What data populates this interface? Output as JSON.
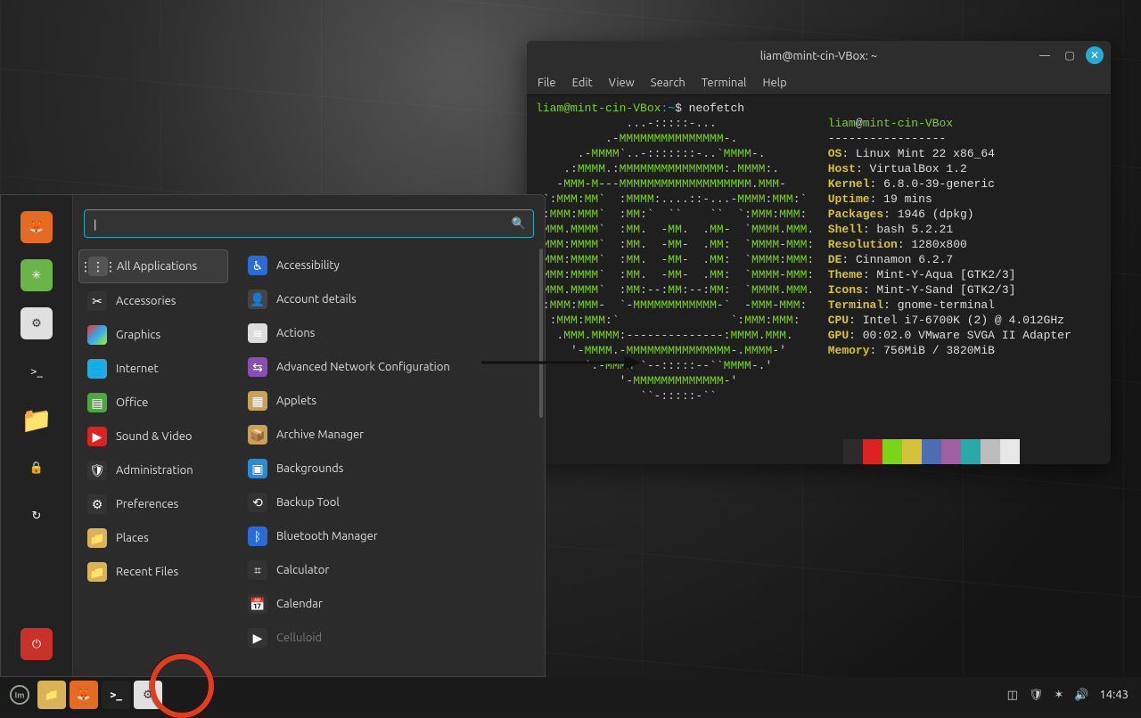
{
  "terminal": {
    "title": "liam@mint-cin-VBox: ~",
    "menu": [
      "File",
      "Edit",
      "View",
      "Search",
      "Terminal",
      "Help"
    ],
    "prompt_user": "liam@mint-cin-VBox",
    "prompt_path": "~",
    "command": "neofetch",
    "info_user": "liam",
    "info_host": "mint-cin-VBox",
    "hr": "-----------------",
    "stats": [
      {
        "k": "OS",
        "v": "Linux Mint 22 x86_64"
      },
      {
        "k": "Host",
        "v": "VirtualBox 1.2"
      },
      {
        "k": "Kernel",
        "v": "6.8.0-39-generic"
      },
      {
        "k": "Uptime",
        "v": "19 mins"
      },
      {
        "k": "Packages",
        "v": "1946 (dpkg)"
      },
      {
        "k": "Shell",
        "v": "bash 5.2.21"
      },
      {
        "k": "Resolution",
        "v": "1280x800"
      },
      {
        "k": "DE",
        "v": "Cinnamon 6.2.7"
      },
      {
        "k": "Theme",
        "v": "Mint-Y-Aqua [GTK2/3]"
      },
      {
        "k": "Icons",
        "v": "Mint-Y-Sand [GTK2/3]"
      },
      {
        "k": "Terminal",
        "v": "gnome-terminal"
      },
      {
        "k": "CPU",
        "v": "Intel i7-6700K (2) @ 4.012GHz"
      },
      {
        "k": "GPU",
        "v": "00:02.0 VMware SVGA II Adapter"
      },
      {
        "k": "Memory",
        "v": "756MiB / 3820MiB"
      }
    ],
    "palette": [
      "#2b2b2b",
      "#d22",
      "#7ad417",
      "#d6c13b",
      "#4d6db5",
      "#a05fa0",
      "#2aa9a9",
      "#bdbdbd",
      "#e7e7e7"
    ],
    "ascii": [
      "             ...-:::::-...",
      "          .-MMMMMMMMMMMMMMM-.",
      "      .-MMMM`..-:::::::-..`MMMM-.",
      "    .:MMMM.:MMMMMMMMMMMMMMM:.MMMM:.",
      "   -MMM-M---MMMMMMMMMMMMMMMMMMM.MMM-",
      " `:MMM:MM`  :MMMM:....::-...-MMMM:MMM:`",
      " :MMM:MMM`  :MM:`  ``    ``  `:MMM:MMM:",
      ".MMM.MMMM`  :MM.  -MM.  .MM-  `MMMM.MMM.",
      ":MMM:MMMM`  :MM.  -MM-  .MM:  `MMMM-MMM:",
      ":MMM:MMMM`  :MM.  -MM-  .MM:  `MMMM:MMM:",
      ":MMM:MMMM`  :MM.  -MM-  .MM:  `MMMM-MMM:",
      ".MMM.MMMM`  :MM:--:MM:--:MM:  `MMMM.MMM.",
      " :MMM:MMM-  `-MMMMMMMMMMMM-`  -MMM-MMM:",
      "  :MMM:MMM:`                `:MMM:MMM:",
      "   .MMM.MMMM:--------------:MMMM.MMM.",
      "     '-MMMM.-MMMMMMMMMMMMMMM-.MMMM-'",
      "       '.-MMMM``--:::::--``MMMM-.'",
      "            '-MMMMMMMMMMMMM-'",
      "               ``-:::::-``"
    ]
  },
  "menu": {
    "search_placeholder": "",
    "categories": [
      {
        "label": "All Applications",
        "active": true,
        "icon": "#555",
        "glyph": "⋮⋮⋮"
      },
      {
        "label": "Accessories",
        "icon": "#333",
        "glyph": "✂"
      },
      {
        "label": "Graphics",
        "icon": "linear-gradient(135deg,#e33,#3ae,#ae3)",
        "glyph": ""
      },
      {
        "label": "Internet",
        "icon": "#2aa9d6",
        "glyph": "🌐"
      },
      {
        "label": "Office",
        "icon": "#4da73e",
        "glyph": "▤"
      },
      {
        "label": "Sound & Video",
        "icon": "#d22",
        "glyph": "▶"
      },
      {
        "label": "Administration",
        "icon": "#333",
        "glyph": "🛡"
      },
      {
        "label": "Preferences",
        "icon": "#333",
        "glyph": "⚙"
      },
      {
        "label": "Places",
        "icon": "#d9b35a",
        "glyph": "📁"
      },
      {
        "label": "Recent Files",
        "icon": "#d9b35a",
        "glyph": "📁"
      }
    ],
    "apps": [
      {
        "label": "Accessibility",
        "icon": "#2a6bd6",
        "glyph": "♿"
      },
      {
        "label": "Account details",
        "icon": "#444",
        "glyph": "👤"
      },
      {
        "label": "Actions",
        "icon": "#ddd",
        "glyph": "≡"
      },
      {
        "label": "Advanced Network Configuration",
        "icon": "#8a4fb3",
        "glyph": "⇆"
      },
      {
        "label": "Applets",
        "icon": "#c9a15a",
        "glyph": "▦"
      },
      {
        "label": "Archive Manager",
        "icon": "#c9a15a",
        "glyph": "📦"
      },
      {
        "label": "Backgrounds",
        "icon": "#2a8bd6",
        "glyph": "▣"
      },
      {
        "label": "Backup Tool",
        "icon": "#333",
        "glyph": "⟲"
      },
      {
        "label": "Bluetooth Manager",
        "icon": "#2a6bd6",
        "glyph": "ᛒ"
      },
      {
        "label": "Calculator",
        "icon": "#333",
        "glyph": "⌗"
      },
      {
        "label": "Calendar",
        "icon": "#333",
        "glyph": "📅"
      },
      {
        "label": "Celluloid",
        "dim": true,
        "icon": "#333",
        "glyph": "▶"
      }
    ],
    "sidebar_icons": [
      {
        "name": "firefox-icon",
        "bg": "#e66b22",
        "glyph": "🦊"
      },
      {
        "name": "chat-icon",
        "bg": "#6ab44a",
        "glyph": "✳"
      },
      {
        "name": "settings-icon",
        "bg": "#e0e0e0",
        "glyph": "⚙"
      },
      {
        "name": "terminal-icon",
        "bg": "#222",
        "glyph": ">_"
      },
      {
        "name": "files-icon",
        "bg": "#d9b35a",
        "glyph": "📁"
      },
      {
        "name": "lock-icon",
        "bg": "#222",
        "glyph": "🔒"
      },
      {
        "name": "logout-icon",
        "bg": "#222",
        "glyph": "↻"
      },
      {
        "name": "power-icon",
        "bg": "#c8322a",
        "glyph": "⏻"
      }
    ]
  },
  "taskbar": {
    "launchers": [
      {
        "name": "menu-button",
        "bg": "#222",
        "glyph": "LM"
      },
      {
        "name": "files-launcher",
        "bg": "#d9b35a",
        "glyph": "📁"
      },
      {
        "name": "firefox-launcher",
        "bg": "#e66b22",
        "glyph": "🦊"
      },
      {
        "name": "terminal-launcher",
        "bg": "#222",
        "glyph": ">_"
      },
      {
        "name": "settings-launcher",
        "bg": "#e0e0e0",
        "glyph": "⚙"
      }
    ],
    "tray": [
      {
        "name": "workspace-icon",
        "glyph": "◫"
      },
      {
        "name": "shield-icon",
        "glyph": "🛡"
      },
      {
        "name": "network-icon",
        "glyph": "✶"
      },
      {
        "name": "volume-icon",
        "glyph": "🔊"
      }
    ],
    "clock": "14:43"
  }
}
